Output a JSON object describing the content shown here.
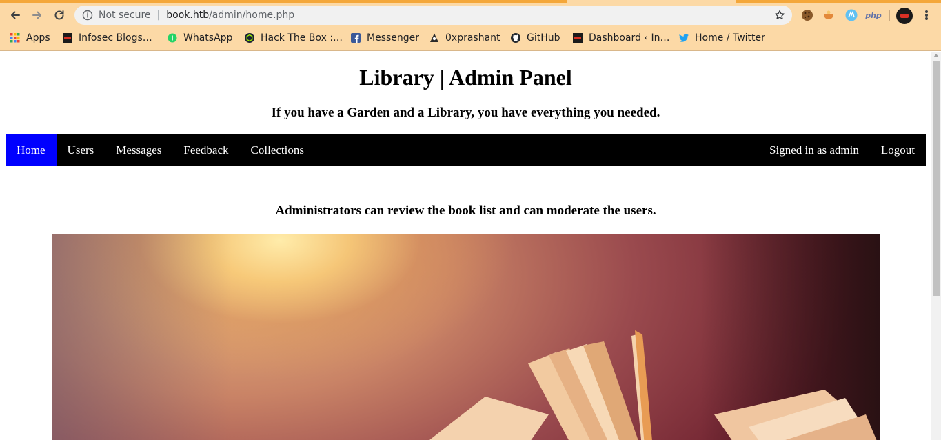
{
  "browser": {
    "url": {
      "security_label": "Not secure",
      "host": "book.htb",
      "path": "/admin/home.php"
    },
    "bookmarks": [
      {
        "label": "Apps",
        "icon": "apps-grid-icon"
      },
      {
        "label": "Infosec Blogs…",
        "icon": "infosec-favicon-icon"
      },
      {
        "label": "WhatsApp",
        "icon": "whatsapp-icon"
      },
      {
        "label": "Hack The Box :…",
        "icon": "hackthebox-icon"
      },
      {
        "label": "Messenger",
        "icon": "facebook-icon"
      },
      {
        "label": "0xprashant",
        "icon": "0xprashant-favicon-icon"
      },
      {
        "label": "GitHub",
        "icon": "github-icon"
      },
      {
        "label": "Dashboard ‹ In…",
        "icon": "dashboard-favicon-icon"
      },
      {
        "label": "Home / Twitter",
        "icon": "twitter-icon"
      }
    ],
    "extensions": {
      "php_label": "php"
    },
    "colors": {
      "toolbar_bg": "#fcd9a6",
      "tab_accent": "#f4a73a"
    }
  },
  "page": {
    "title": "Library | Admin Panel",
    "tagline": "If you have a Garden and a Library, you have everything you needed.",
    "nav": {
      "items": [
        {
          "label": "Home",
          "active": true
        },
        {
          "label": "Users",
          "active": false
        },
        {
          "label": "Messages",
          "active": false
        },
        {
          "label": "Feedback",
          "active": false
        },
        {
          "label": "Collections",
          "active": false
        }
      ],
      "signed_in": "Signed in as admin",
      "logout": "Logout"
    },
    "intro": "Administrators can review the book list and can moderate the users.",
    "hero_image": "open-book-photo",
    "colors": {
      "nav_bg": "#000000",
      "nav_active": "#0000ff"
    }
  }
}
